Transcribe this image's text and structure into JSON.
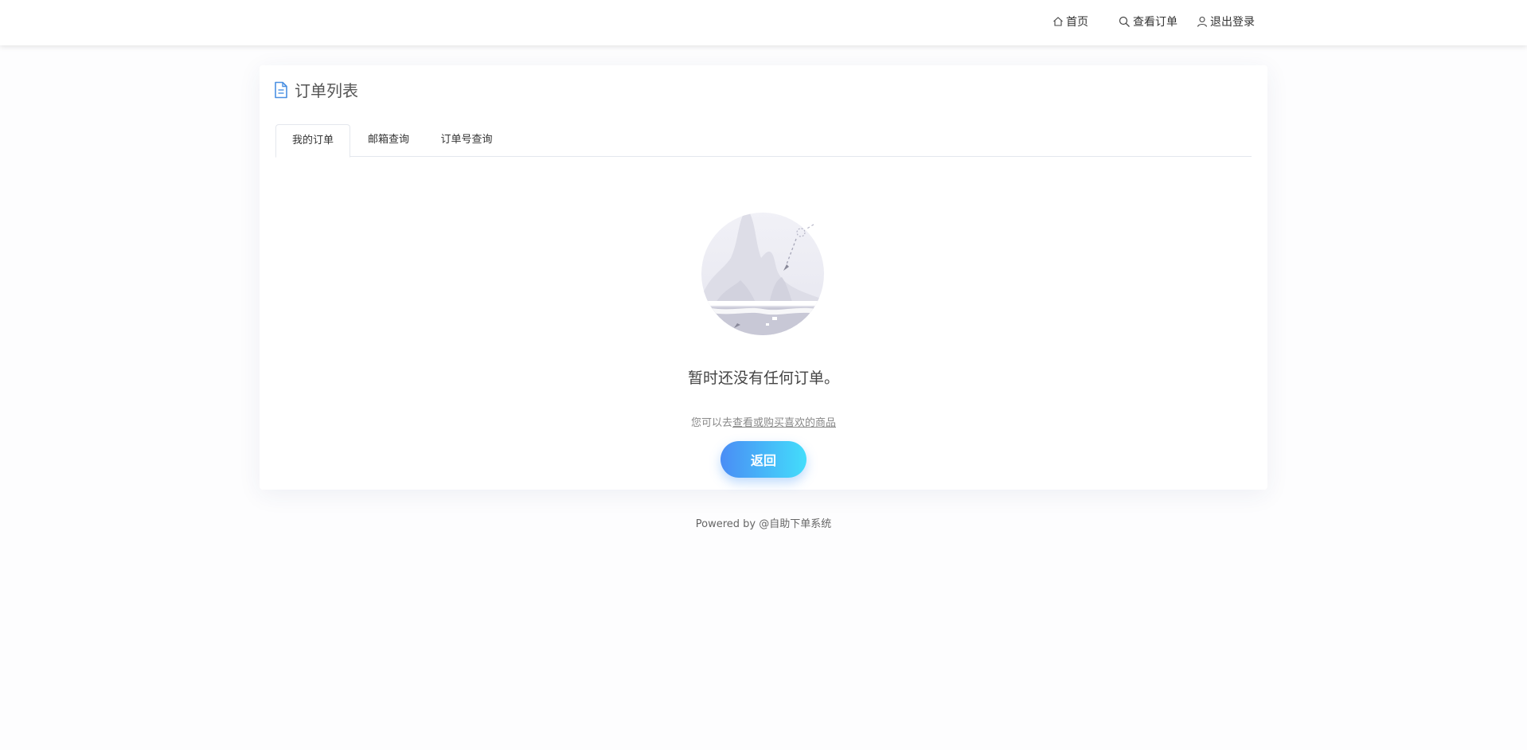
{
  "nav": {
    "home_label": "首页",
    "orders_label": "查看订单",
    "logout_label": "退出登录"
  },
  "card": {
    "title": "订单列表",
    "tabs": [
      {
        "label": "我的订单",
        "active": true
      },
      {
        "label": "邮箱查询",
        "active": false
      },
      {
        "label": "订单号查询",
        "active": false
      }
    ]
  },
  "empty": {
    "title": "暂时还没有任何订单。",
    "hint_prefix": "您可以去",
    "hint_link": "查看或购买喜欢的商品",
    "button_label": "返回"
  },
  "footer": {
    "text": "Powered by @自助下单系统"
  },
  "colors": {
    "accent_start": "#4a8df5",
    "accent_end": "#43ddfb",
    "title_icon": "#4a90e2"
  },
  "icons": {
    "home": "home-icon",
    "search": "search-icon",
    "user": "user-icon",
    "document": "document-icon",
    "empty_illustration": "empty-illustration"
  }
}
